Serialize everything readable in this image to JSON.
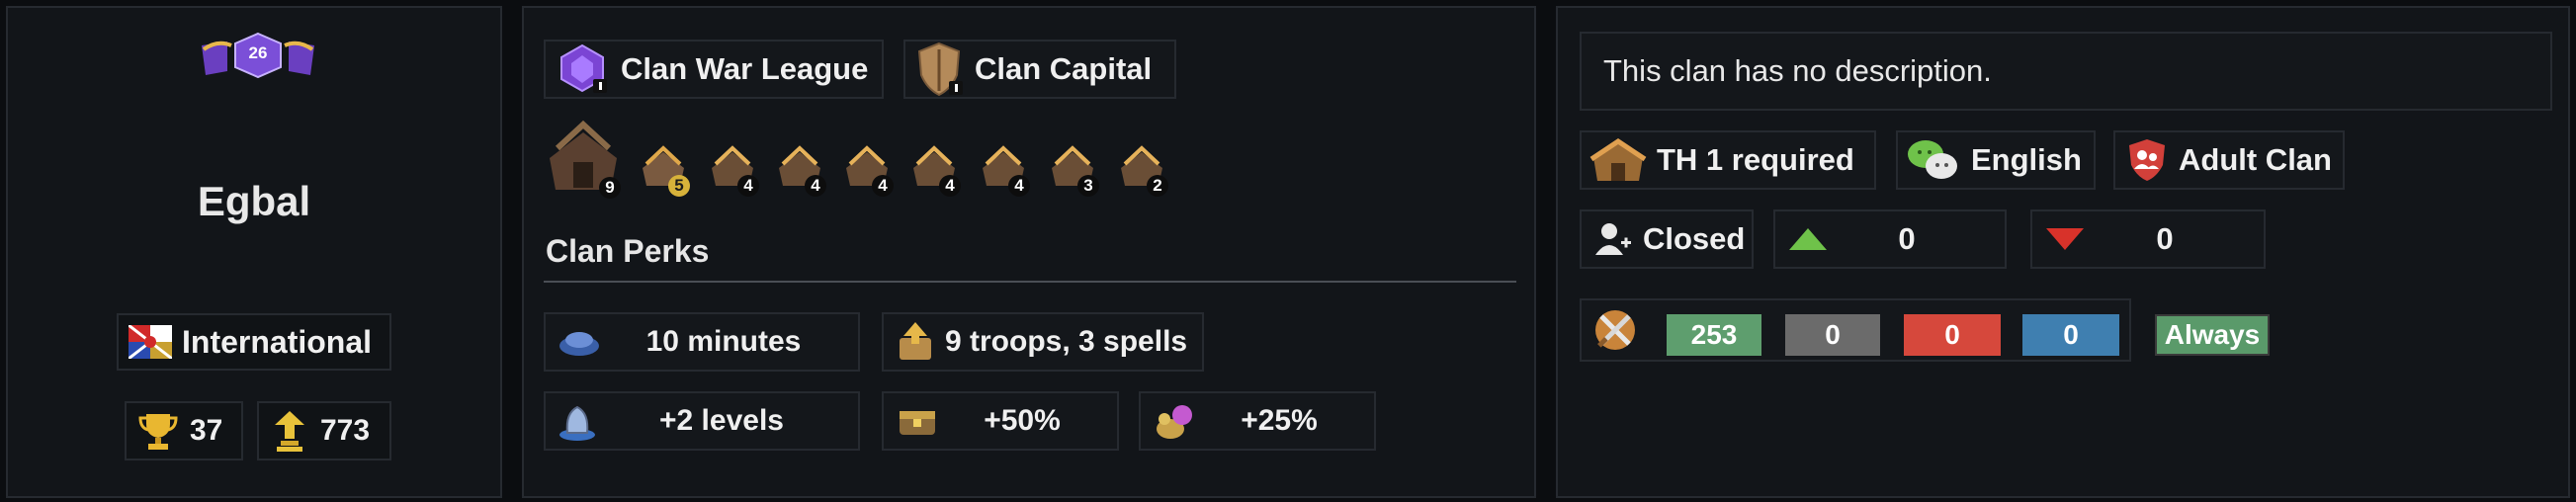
{
  "left": {
    "level": "26",
    "clan_name": "Egbal",
    "location": "International",
    "trophies": "37",
    "builder_trophies": "773"
  },
  "middle": {
    "cwl_label": "Clan War League",
    "capital_label": "Clan Capital",
    "building_levels": [
      "9",
      "5",
      "4",
      "4",
      "4",
      "4",
      "4",
      "3",
      "2"
    ],
    "perks_title": "Clan Perks",
    "perks": [
      {
        "icon": "donation-timer-icon",
        "value": "10 minutes"
      },
      {
        "icon": "troop-request-icon",
        "value": "9 troops, 3 spells"
      },
      {
        "icon": "donation-upgrade-icon",
        "value": "+2 levels"
      },
      {
        "icon": "treasury-icon",
        "value": "+50%"
      },
      {
        "icon": "war-bonus-icon",
        "value": "+25%"
      }
    ]
  },
  "right": {
    "description": "This clan has no description.",
    "th_required": "TH 1 required",
    "language": "English",
    "clan_type": "Adult Clan",
    "join_type": "Closed",
    "up_value": "0",
    "down_value": "0",
    "war": {
      "wins": "253",
      "ties": "0",
      "losses": "0",
      "streak": "0",
      "frequency": "Always"
    }
  },
  "colors": {
    "win": "#5e9e6e",
    "tie": "#6b6b6b",
    "loss": "#d6483c",
    "streak": "#3f7fb0",
    "frequency": "#5a9a6a"
  }
}
